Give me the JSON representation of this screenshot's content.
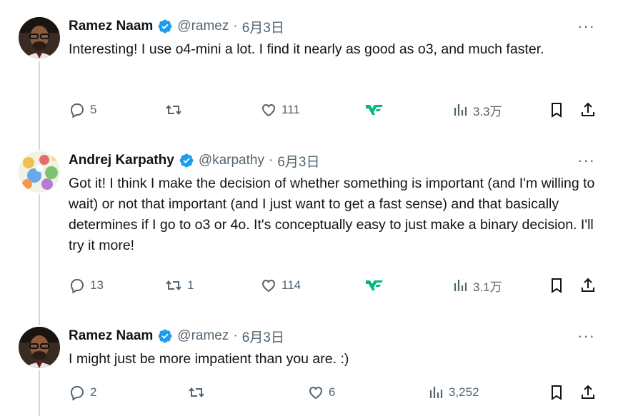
{
  "tweets": [
    {
      "name": "Ramez Naam",
      "handle": "@ramez",
      "date": "6月3日",
      "text": "Interesting! I use o4-mini a lot. I find it nearly as good as o3, and much faster.",
      "replies": "5",
      "reposts": "",
      "likes": "111",
      "views": "3.3万"
    },
    {
      "name": "Andrej Karpathy",
      "handle": "@karpathy",
      "date": "6月3日",
      "text": "Got it! I think I make the decision of whether something is important (and I'm willing to wait) or not that important (and I just want to get a fast sense) and that basically determines if I go to o3 or 4o. It's conceptually easy to just make a binary decision. I'll try it more!",
      "replies": "13",
      "reposts": "1",
      "likes": "114",
      "views": "3.1万"
    },
    {
      "name": "Ramez Naam",
      "handle": "@ramez",
      "date": "6月3日",
      "text": "I might just be more impatient than you are. :)",
      "replies": "2",
      "reposts": "",
      "likes": "6",
      "views": "3,252"
    }
  ],
  "separator": "·",
  "more_label": "···",
  "colors": {
    "verified": "#1d9bf0",
    "text_secondary": "#536471",
    "grok": "#00ba7c",
    "thread_line": "#cfd9de"
  },
  "icons": [
    "reply-icon",
    "repost-icon",
    "like-icon",
    "grok-icon",
    "views-icon",
    "bookmark-icon",
    "share-icon",
    "verified-icon",
    "more-icon"
  ]
}
